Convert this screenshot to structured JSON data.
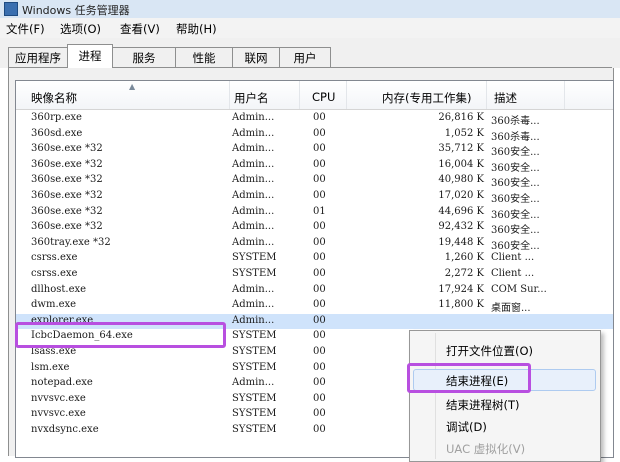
{
  "window": {
    "title": "Windows 任务管理器"
  },
  "menu": [
    {
      "name": "menu-file",
      "label": "文件(F)"
    },
    {
      "name": "menu-options",
      "label": "选项(O)"
    },
    {
      "name": "menu-view",
      "label": "查看(V)"
    },
    {
      "name": "menu-help",
      "label": "帮助(H)"
    }
  ],
  "tabs": [
    {
      "name": "tab-applications",
      "label": "应用程序"
    },
    {
      "name": "tab-processes",
      "label": "进程",
      "active": true
    },
    {
      "name": "tab-services",
      "label": "服务"
    },
    {
      "name": "tab-performance",
      "label": "性能"
    },
    {
      "name": "tab-networking",
      "label": "联网"
    },
    {
      "name": "tab-users",
      "label": "用户"
    }
  ],
  "columns": {
    "name": "映像名称",
    "user": "用户名",
    "cpu": "CPU",
    "memory": "内存(专用工作集)",
    "description": "描述"
  },
  "processes": [
    {
      "name": "360rp.exe",
      "user": "Admin...",
      "cpu": "00",
      "memory": "26,816 K",
      "desc": "360杀毒..."
    },
    {
      "name": "360sd.exe",
      "user": "Admin...",
      "cpu": "00",
      "memory": "1,052 K",
      "desc": "360杀毒..."
    },
    {
      "name": "360se.exe *32",
      "user": "Admin...",
      "cpu": "00",
      "memory": "35,712 K",
      "desc": "360安全..."
    },
    {
      "name": "360se.exe *32",
      "user": "Admin...",
      "cpu": "00",
      "memory": "16,004 K",
      "desc": "360安全..."
    },
    {
      "name": "360se.exe *32",
      "user": "Admin...",
      "cpu": "00",
      "memory": "40,980 K",
      "desc": "360安全..."
    },
    {
      "name": "360se.exe *32",
      "user": "Admin...",
      "cpu": "00",
      "memory": "17,020 K",
      "desc": "360安全..."
    },
    {
      "name": "360se.exe *32",
      "user": "Admin...",
      "cpu": "01",
      "memory": "44,696 K",
      "desc": "360安全..."
    },
    {
      "name": "360se.exe *32",
      "user": "Admin...",
      "cpu": "00",
      "memory": "92,432 K",
      "desc": "360安全..."
    },
    {
      "name": "360tray.exe *32",
      "user": "Admin...",
      "cpu": "00",
      "memory": "19,448 K",
      "desc": "360安全..."
    },
    {
      "name": "csrss.exe",
      "user": "SYSTEM",
      "cpu": "00",
      "memory": "1,260 K",
      "desc": "Client ..."
    },
    {
      "name": "csrss.exe",
      "user": "SYSTEM",
      "cpu": "00",
      "memory": "2,272 K",
      "desc": "Client ..."
    },
    {
      "name": "dllhost.exe",
      "user": "Admin...",
      "cpu": "00",
      "memory": "17,924 K",
      "desc": "COM Sur..."
    },
    {
      "name": "dwm.exe",
      "user": "Admin...",
      "cpu": "00",
      "memory": "11,800 K",
      "desc": "桌面窗..."
    },
    {
      "name": "explorer.exe",
      "user": "Admin...",
      "cpu": "00",
      "memory": "",
      "desc": "",
      "selected": true
    },
    {
      "name": "IcbcDaemon_64.exe",
      "user": "SYSTEM",
      "cpu": "00",
      "memory": "",
      "desc": ""
    },
    {
      "name": "lsass.exe",
      "user": "SYSTEM",
      "cpu": "00",
      "memory": "",
      "desc": ""
    },
    {
      "name": "lsm.exe",
      "user": "SYSTEM",
      "cpu": "00",
      "memory": "",
      "desc": ""
    },
    {
      "name": "notepad.exe",
      "user": "Admin...",
      "cpu": "00",
      "memory": "",
      "desc": ""
    },
    {
      "name": "nvvsvc.exe",
      "user": "SYSTEM",
      "cpu": "00",
      "memory": "",
      "desc": ""
    },
    {
      "name": "nvvsvc.exe",
      "user": "SYSTEM",
      "cpu": "00",
      "memory": "",
      "desc": ""
    },
    {
      "name": "nvxdsync.exe",
      "user": "SYSTEM",
      "cpu": "00",
      "memory": "",
      "desc": ""
    }
  ],
  "context_menu": [
    {
      "name": "ctx-open-file-location",
      "label": "打开文件位置(O)"
    },
    {
      "name": "ctx-end-process",
      "label": "结束进程(E)",
      "hover": true
    },
    {
      "name": "ctx-end-process-tree",
      "label": "结束进程树(T)"
    },
    {
      "name": "ctx-debug",
      "label": "调试(D)"
    },
    {
      "name": "ctx-uac-virtualization",
      "label": "UAC 虚拟化(V)",
      "disabled": true
    }
  ],
  "colors": {
    "highlight": "#b84fe0",
    "selection": "#cfe3fb"
  }
}
